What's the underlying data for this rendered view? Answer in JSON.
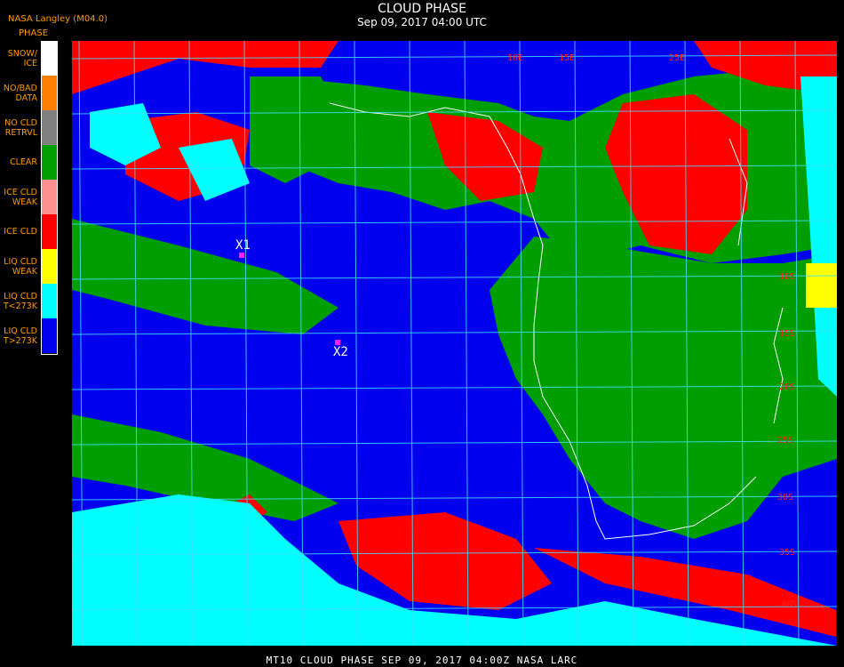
{
  "header": {
    "provider": "NASA Langley (M04.0)",
    "product_label": "PHASE",
    "title": "CLOUD PHASE",
    "datetime": "Sep 09, 2017 04:00 UTC"
  },
  "legend": [
    {
      "label": "SNOW/\nICE",
      "color": "#ffffff"
    },
    {
      "label": "NO/BAD\nDATA",
      "color": "#ff8000"
    },
    {
      "label": "NO CLD\nRETRVL",
      "color": "#808080"
    },
    {
      "label": "CLEAR",
      "color": "#00a000"
    },
    {
      "label": "ICE CLD\nWEAK",
      "color": "#ff9090"
    },
    {
      "label": "ICE CLD",
      "color": "#ff0000"
    },
    {
      "label": "LIQ CLD\nWEAK",
      "color": "#ffff00"
    },
    {
      "label": "LIQ CLD\nT<273K",
      "color": "#00ffff"
    },
    {
      "label": "LIQ CLD\nT>273K",
      "color": "#0000ee"
    }
  ],
  "markers": [
    {
      "label": "X1"
    },
    {
      "label": "X2"
    }
  ],
  "grid_labels": {
    "lon": [
      "10E",
      "15E",
      "25E"
    ],
    "lat": [
      "10S",
      "15S",
      "20S",
      "25S",
      "30S",
      "35S",
      "40S"
    ]
  },
  "footer": "MT10   CLOUD PHASE   SEP 09, 2017 04:00Z   NASA LARC"
}
